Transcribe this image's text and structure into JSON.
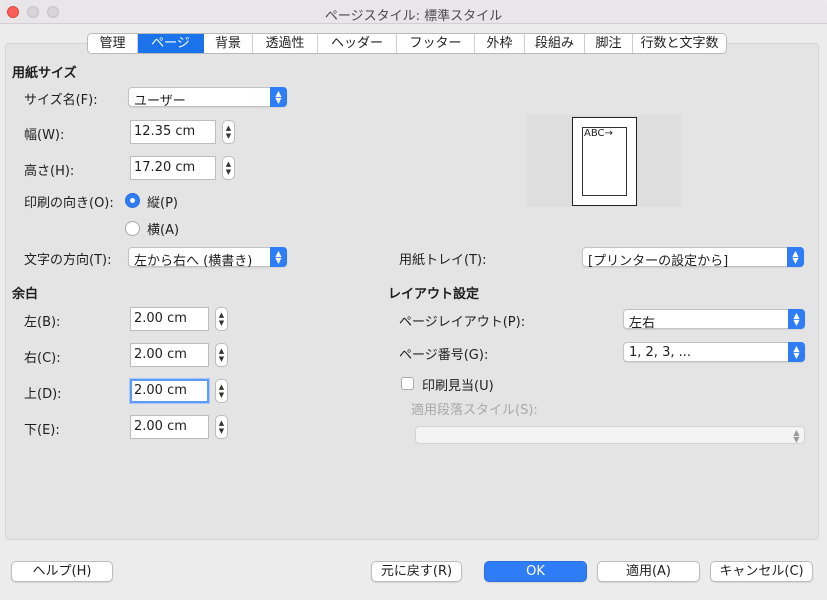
{
  "window": {
    "title": "ページスタイル: 標準スタイル"
  },
  "tabs": [
    {
      "label": "管理"
    },
    {
      "label": "ページ"
    },
    {
      "label": "背景"
    },
    {
      "label": "透過性"
    },
    {
      "label": "ヘッダー"
    },
    {
      "label": "フッター"
    },
    {
      "label": "外枠"
    },
    {
      "label": "段組み"
    },
    {
      "label": "脚注"
    },
    {
      "label": "行数と文字数"
    }
  ],
  "paper": {
    "heading": "用紙サイズ",
    "format_label": "サイズ名(F):",
    "format_value": "ユーザー",
    "width_label": "幅(W):",
    "width_value": "12.35 cm",
    "height_label": "高さ(H):",
    "height_value": "17.20 cm",
    "orientation_label": "印刷の向き(O):",
    "portrait_label": "縦(P)",
    "landscape_label": "横(A)",
    "text_direction_label": "文字の方向(T):",
    "text_direction_value": "左から右へ (横書き)",
    "tray_label": "用紙トレイ(T):",
    "tray_value": "[プリンターの設定から]",
    "preview_text": "ABC→"
  },
  "margins": {
    "heading": "余白",
    "left_label": "左(B):",
    "left_value": "2.00 cm",
    "right_label": "右(C):",
    "right_value": "2.00 cm",
    "top_label": "上(D):",
    "top_value": "2.00 cm",
    "bottom_label": "下(E):",
    "bottom_value": "2.00 cm"
  },
  "layout": {
    "heading": "レイアウト設定",
    "page_layout_label": "ページレイアウト(P):",
    "page_layout_value": "左右",
    "page_number_label": "ページ番号(G):",
    "page_number_value": "1, 2, 3, ...",
    "register_true_label": "印刷見当(U)",
    "reference_style_label": "適用段落スタイル(S):",
    "reference_style_value": ""
  },
  "buttons": {
    "help": "ヘルプ(H)",
    "reset": "元に戻す(R)",
    "ok": "OK",
    "apply": "適用(A)",
    "cancel": "キャンセル(C)"
  },
  "icons": {
    "spin": "stepper-arrows-icon",
    "select": "chevron-updown-icon"
  },
  "colors": {
    "accent": "#2f7df6",
    "tab_active": "#1a73ea",
    "close": "#fc5f57"
  }
}
